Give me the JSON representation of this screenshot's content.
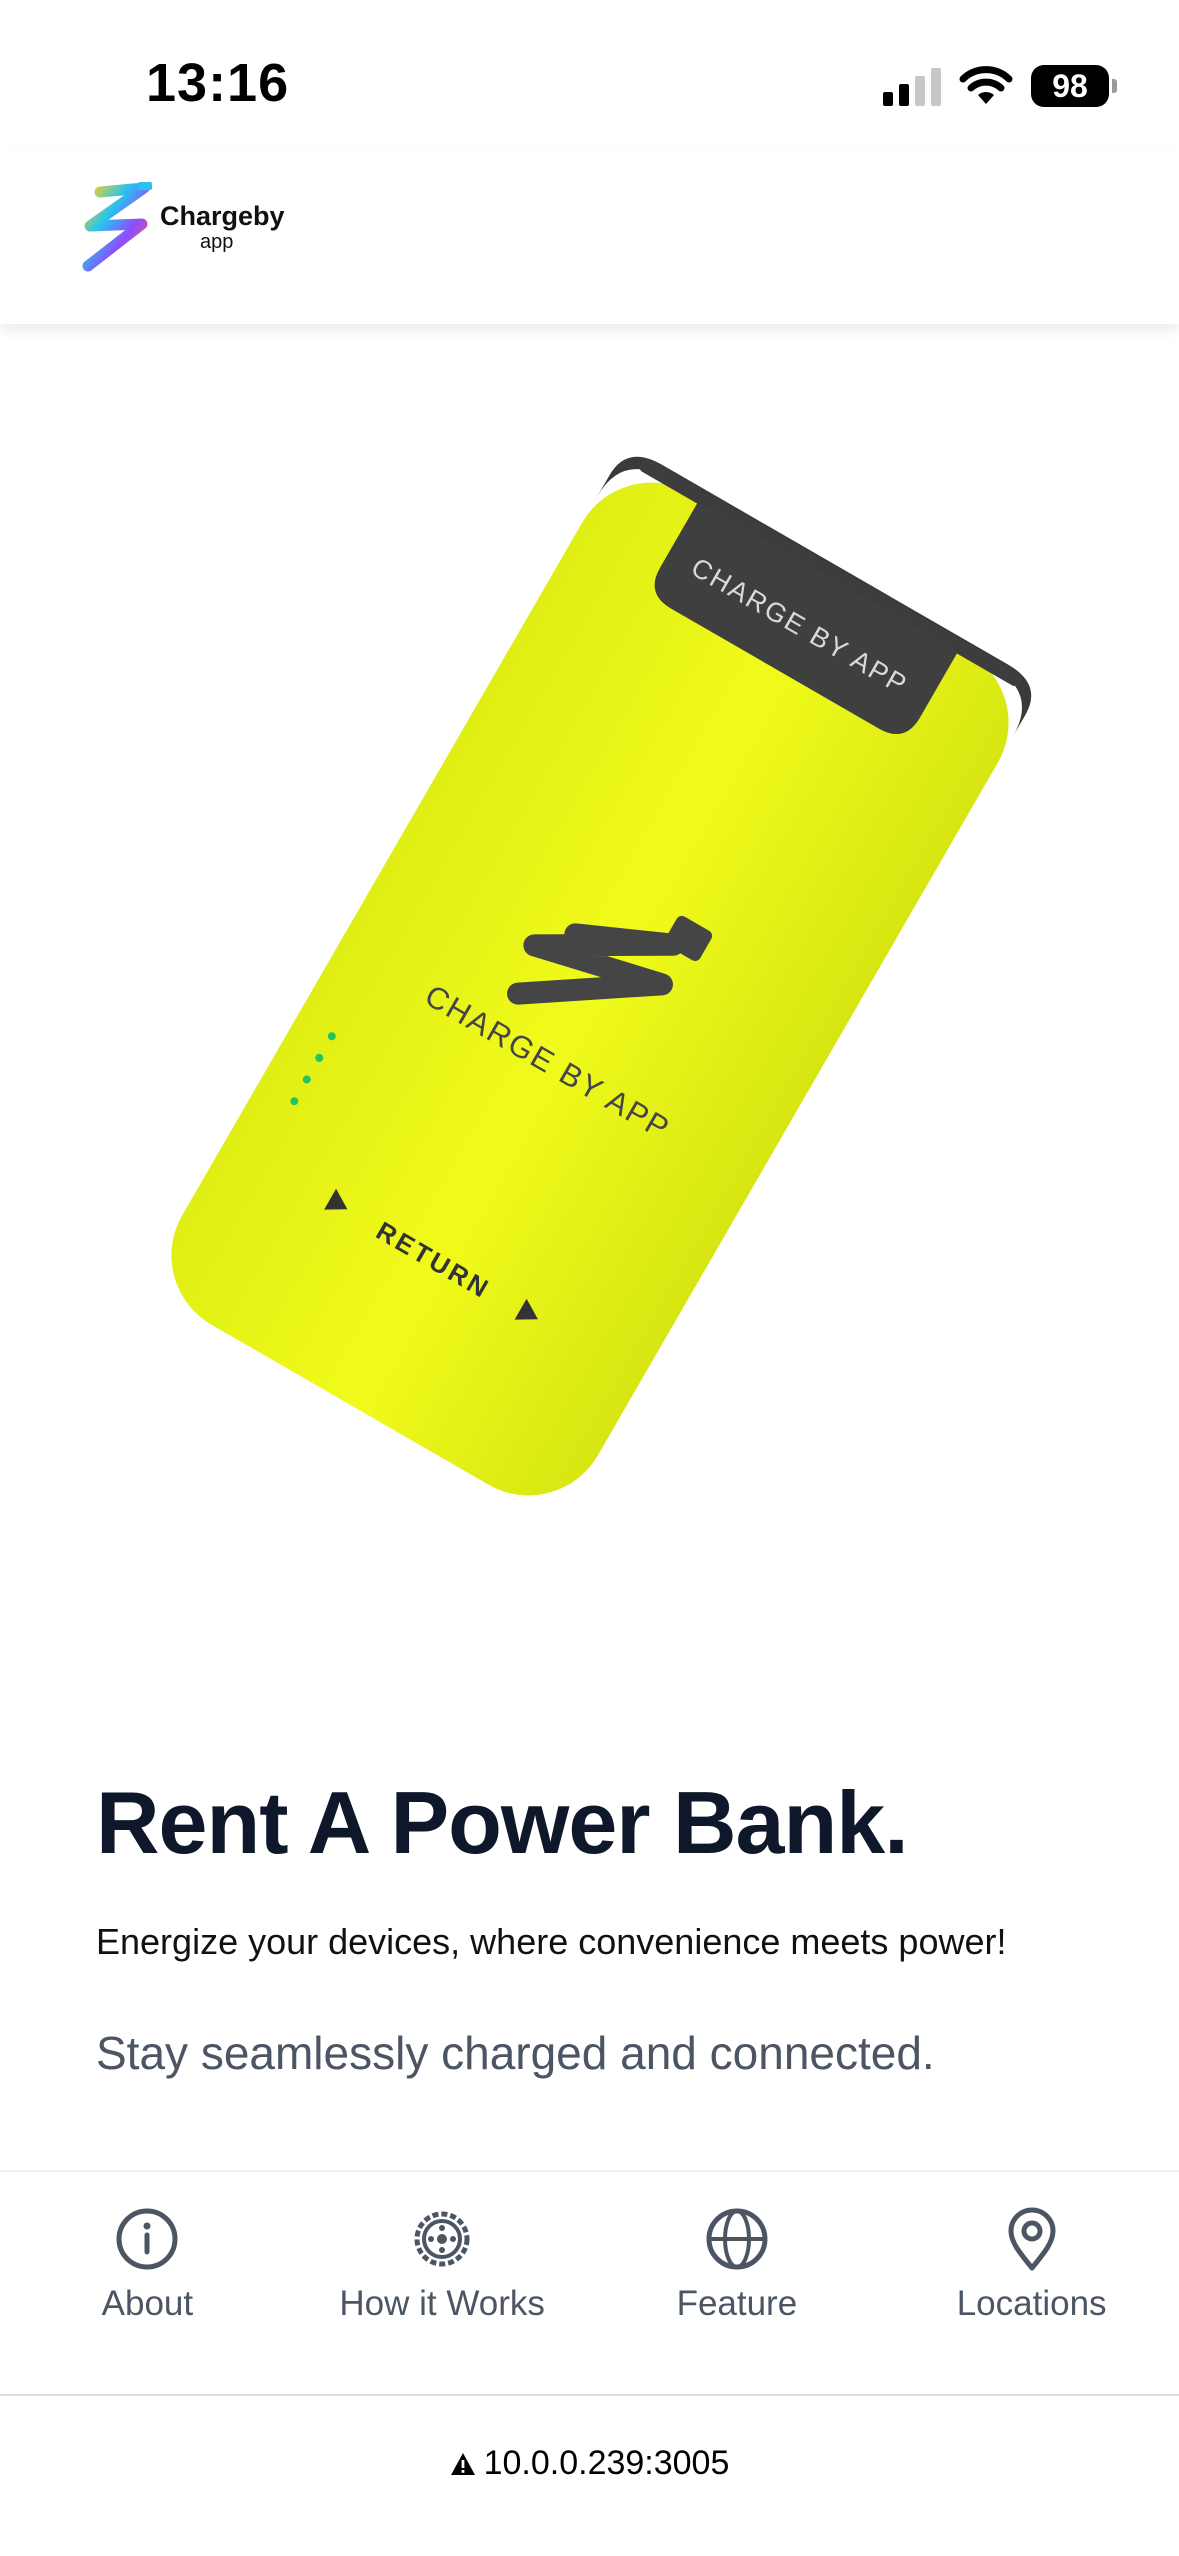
{
  "status_bar": {
    "time": "13:16",
    "battery": "98"
  },
  "header": {
    "logo_name": "Chargeby",
    "logo_sub": "app"
  },
  "hero": {
    "device_label_top": "CHARGE BY APP",
    "device_label_center": "CHARGE BY APP",
    "device_label_return": "RETURN",
    "device_color": "#eaf718"
  },
  "main": {
    "title": "Rent A Power Bank.",
    "subtitle": "Energize your devices, where convenience meets power!",
    "lead": "Stay seamlessly charged and connected."
  },
  "bottom_nav": {
    "items": [
      {
        "label": "About",
        "icon": "info-icon"
      },
      {
        "label": "How it Works",
        "icon": "gear-icon"
      },
      {
        "label": "Feature",
        "icon": "globe-icon"
      },
      {
        "label": "Locations",
        "icon": "map-pin-icon"
      }
    ]
  },
  "browser": {
    "url": "10.0.0.239:3005",
    "warning_icon": "warning-icon"
  },
  "colors": {
    "accent_text": "#0f172a",
    "muted_text": "#4b5563",
    "device_yellow": "#eaf718"
  }
}
